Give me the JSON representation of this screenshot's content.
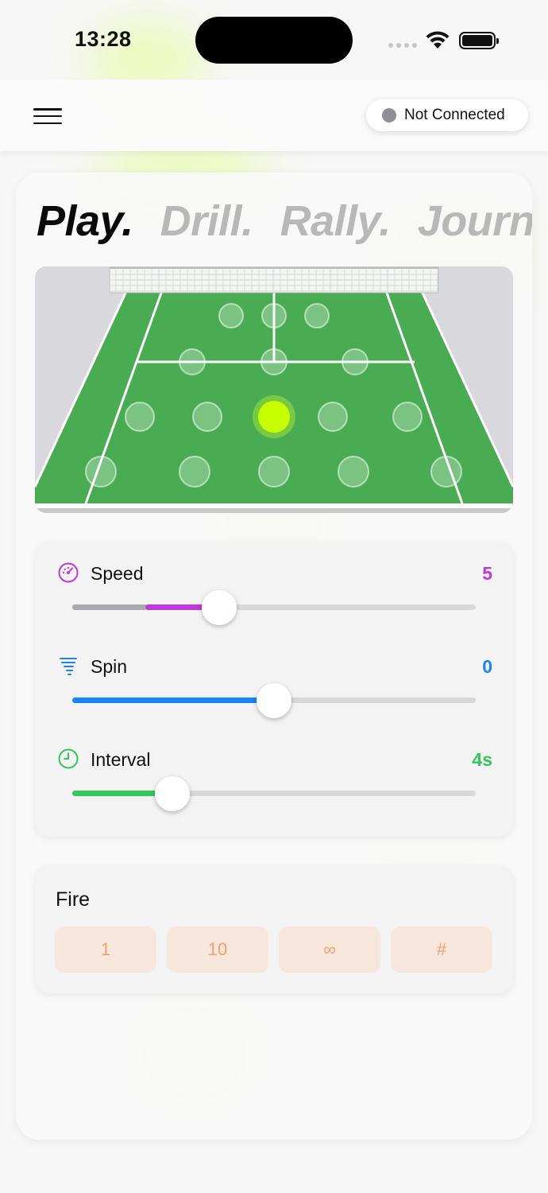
{
  "status_bar": {
    "time": "13:28"
  },
  "header": {
    "connection_status": "Not Connected",
    "connection_dot_color": "#8e8e93"
  },
  "tabs": [
    {
      "label": "Play.",
      "active": true
    },
    {
      "label": "Drill.",
      "active": false
    },
    {
      "label": "Rally.",
      "active": false
    },
    {
      "label": "Journey",
      "active": false
    }
  ],
  "court": {
    "target_count": 18,
    "selected_target": "center-middle",
    "selected_color": "#c8ff00"
  },
  "sliders": {
    "speed": {
      "label": "Speed",
      "value": "5",
      "icon": "speedometer-icon",
      "color": "#c03ad8"
    },
    "spin": {
      "label": "Spin",
      "value": "0",
      "icon": "tornado-icon",
      "color": "#1a84f5"
    },
    "interval": {
      "label": "Interval",
      "value": "4s",
      "icon": "clock-icon",
      "color": "#34c759"
    }
  },
  "fire": {
    "title": "Fire",
    "buttons": [
      "1",
      "10",
      "∞",
      "#"
    ]
  }
}
